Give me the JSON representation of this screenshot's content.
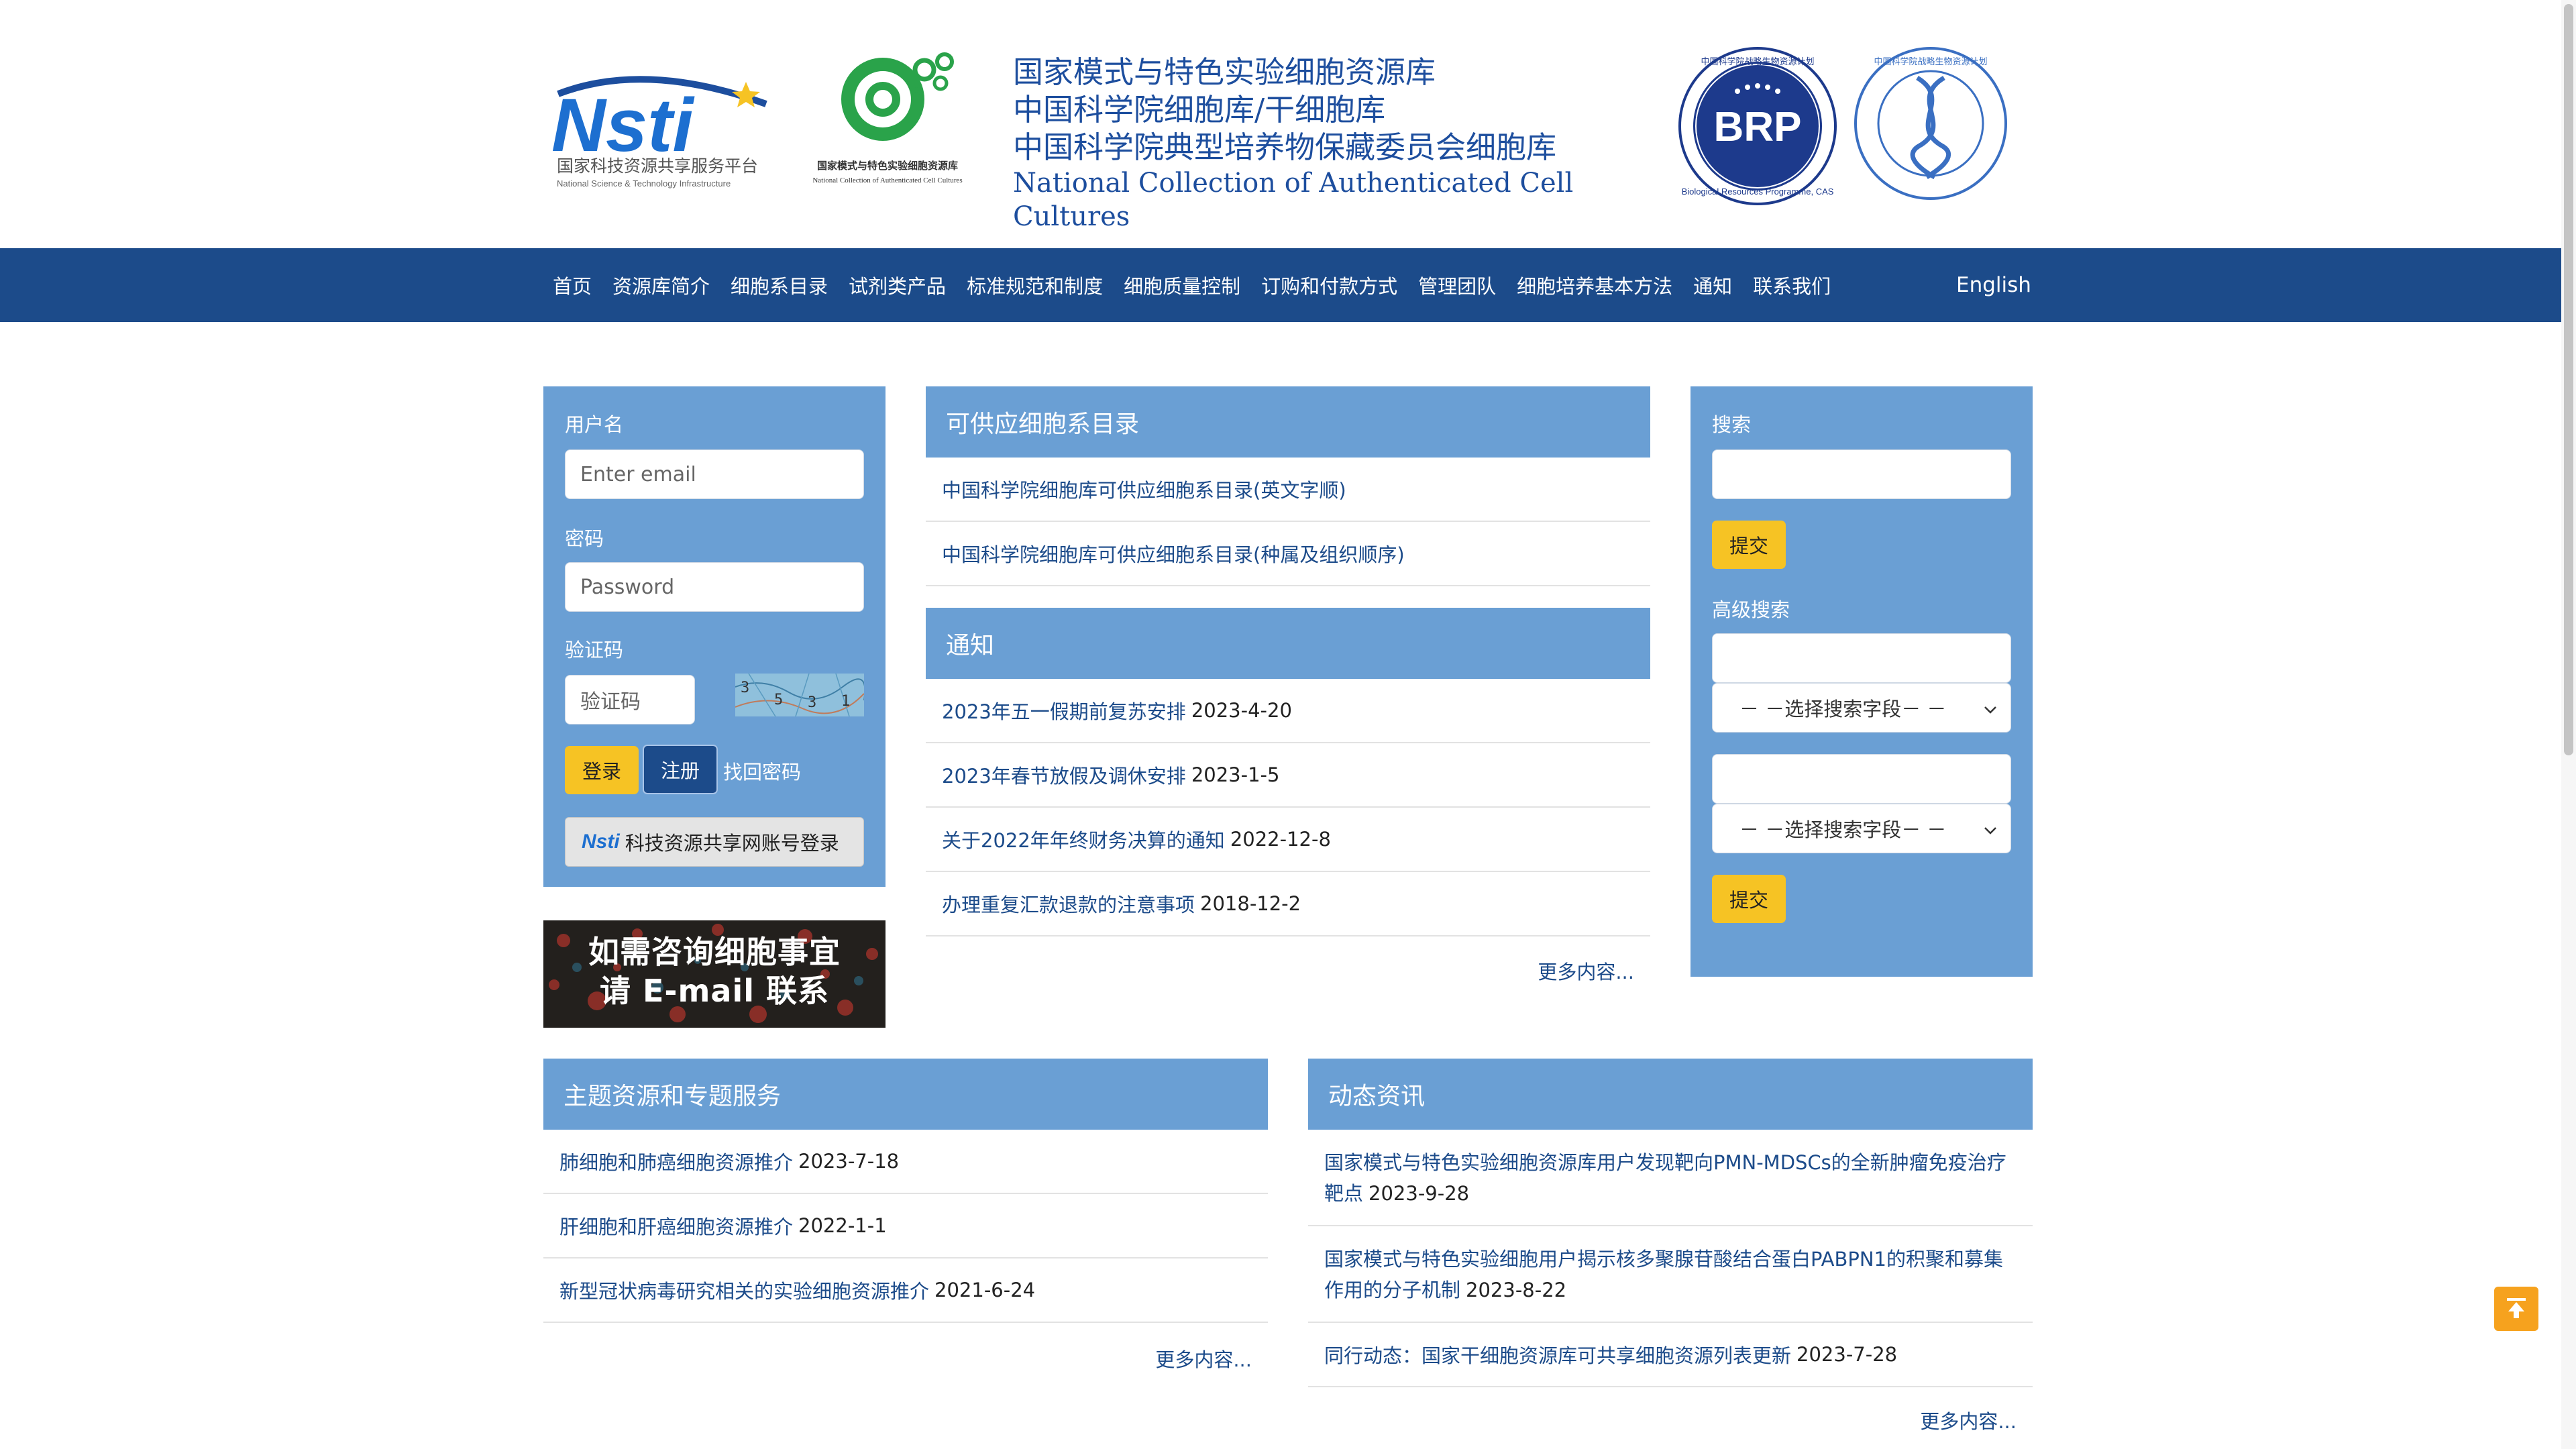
{
  "header": {
    "nsti_logo_text": "Nsti",
    "nsti_logo_cn": "国家科技资源共享服务平台",
    "nsti_logo_en": "National Science & Technology Infrastructure",
    "cell_logo_cn": "国家模式与特色实验细胞资源库",
    "cell_logo_en": "National Collection of Authenticated Cell Cultures",
    "title_lines": [
      "国家模式与特色实验细胞资源库",
      "中国科学院细胞库/干细胞库",
      "中国科学院典型培养物保藏委员会细胞库"
    ],
    "title_en": "National Collection of Authenticated Cell Cultures",
    "brp_badge": "BRP",
    "brp_caption": "Biological Resources Programme, CAS",
    "brp_ring_text": "中国科学院战略生物资源计划",
    "dna_ring_text": "中国科学院战略生物资源计划"
  },
  "nav": {
    "items": [
      "首页",
      "资源库简介",
      "细胞系目录",
      "试剂类产品",
      "标准规范和制度",
      "细胞质量控制",
      "订购和付款方式",
      "管理团队",
      "细胞培养基本方法",
      "通知",
      "联系我们"
    ],
    "english": "English"
  },
  "login": {
    "username_label": "用户名",
    "username_placeholder": "Enter email",
    "password_label": "密码",
    "password_placeholder": "Password",
    "captcha_label": "验证码",
    "captcha_placeholder": "验证码",
    "captcha_digits": [
      "3",
      "5",
      "3",
      "1"
    ],
    "login_button": "登录",
    "register_button": "注册",
    "forgot_link": "找回密码",
    "nsti_button": "科技资源共享网账号登录",
    "nsti_mini_logo": "Nsti"
  },
  "promo": {
    "line1": "如需咨询细胞事宜",
    "line2": "请 E-mail 联系"
  },
  "catalog": {
    "title": "可供应细胞系目录",
    "items": [
      {
        "text": "中国科学院细胞库可供应细胞系目录(英文字顺)"
      },
      {
        "text": "中国科学院细胞库可供应细胞系目录(种属及组织顺序)"
      }
    ]
  },
  "notices": {
    "title": "通知",
    "items": [
      {
        "text": "2023年五一假期前复苏安排",
        "date": "2023-4-20"
      },
      {
        "text": "2023年春节放假及调休安排",
        "date": "2023-1-5"
      },
      {
        "text": "关于2022年年终财务决算的通知",
        "date": "2022-12-8"
      },
      {
        "text": "办理重复汇款退款的注意事项",
        "date": "2018-12-2"
      }
    ],
    "more": "更多内容..."
  },
  "search": {
    "label": "搜索",
    "submit": "提交",
    "advanced_label": "高级搜索",
    "select_placeholder": "－ －选择搜索字段－ －",
    "submit2": "提交"
  },
  "topics": {
    "title": "主题资源和专题服务",
    "items": [
      {
        "text": "肺细胞和肺癌细胞资源推介",
        "date": "2023-7-18"
      },
      {
        "text": "肝细胞和肝癌细胞资源推介",
        "date": "2022-1-1"
      },
      {
        "text": "新型冠状病毒研究相关的实验细胞资源推介",
        "date": "2021-6-24"
      }
    ],
    "more": "更多内容..."
  },
  "news": {
    "title": "动态资讯",
    "items": [
      {
        "line1": "国家模式与特色实验细胞资源库用户发现靶向PMN-MDSCs的全新肿瘤免疫治疗",
        "line2": "靶点",
        "date": "2023-9-28"
      },
      {
        "line1": "国家模式与特色实验细胞用户揭示核多聚腺苷酸结合蛋白PABPN1的积聚和募集",
        "line2": "作用的分子机制",
        "date": "2023-8-22"
      },
      {
        "line1": "同行动态：国家干细胞资源库可共享细胞资源列表更新",
        "line2": "",
        "date": "2023-7-28"
      }
    ],
    "more": "更多内容..."
  },
  "colors": {
    "nav_bg": "#1c4b8a",
    "panel_bg": "#6a9fd4",
    "button_yellow": "#f6c324",
    "link_blue": "#1c4b8a",
    "scroll_top_orange": "#f6a21e"
  },
  "icons": {
    "back_to_top": "arrow-up-to-line-icon",
    "select_caret": "chevron-down-icon"
  }
}
